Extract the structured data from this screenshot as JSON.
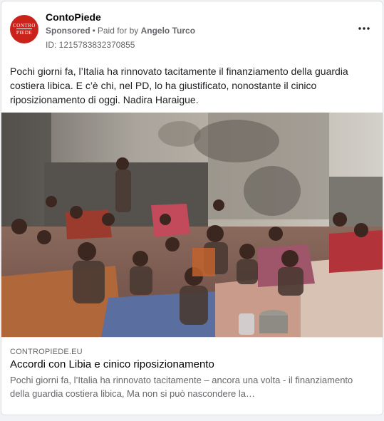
{
  "post": {
    "page_name": "ContoPiede",
    "avatar": {
      "line1": "CONTRO",
      "line2": "PIEDE"
    },
    "sponsored_label": "Sponsored",
    "separator": "•",
    "paid_for_prefix": "Paid for by",
    "payer": "Angelo Turco",
    "ad_id": "ID: 1215783832370855",
    "more_icon": "more-horizontal-icon",
    "text": "Pochi giorni fa, l’Italia ha rinnovato tacitamente il finanziamento della guardia costiera libica. E c’è chi, nel PD, lo ha giustificato, nonostante il cinico riposizionamento di oggi. Nadira Haraigue."
  },
  "link_preview": {
    "domain": "CONTROPIEDE.EU",
    "title": "Accordi con Libia e cinico riposizionamento",
    "description": "Pochi giorni fa, l’Italia ha rinnovato tacitamente – ancora una volta - il finanziamento della guardia costiera libica, Ma non si può nascondere la…"
  }
}
